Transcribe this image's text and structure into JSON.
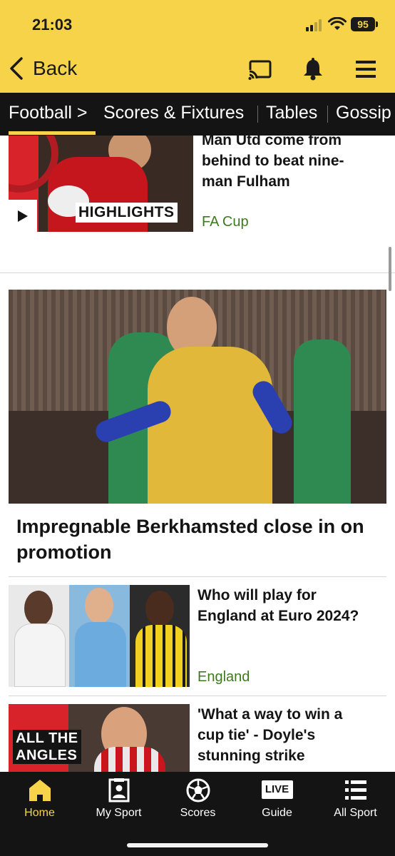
{
  "status_bar": {
    "time": "21:03",
    "battery": "95"
  },
  "header": {
    "back_label": "Back",
    "icons": [
      "cast-icon",
      "bell-icon",
      "menu-icon"
    ]
  },
  "subnav": {
    "items": [
      {
        "label": "Football >",
        "active": true
      },
      {
        "label": "Scores & Fixtures"
      },
      {
        "label": "Tables"
      },
      {
        "label": "Gossip"
      }
    ]
  },
  "articles": [
    {
      "headline_lines": [
        "Man Utd come from",
        "behind to beat nine-",
        "man Fulham"
      ],
      "tag": "FA Cup",
      "thumb_badge": "HIGHLIGHTS",
      "has_play_icon": true
    },
    {
      "headline_lines": [
        "Impregnable Berkhamsted close in on",
        "promotion"
      ]
    },
    {
      "headline_lines": [
        "Who will play for",
        "England at Euro 2024?"
      ],
      "tag": "England"
    },
    {
      "headline_lines": [
        "'What a way to win a",
        "cup tie' - Doyle's",
        "stunning strike"
      ],
      "thumb_badge_lines": [
        "ALL THE",
        "ANGLES"
      ]
    }
  ],
  "tabbar": {
    "tabs": [
      {
        "label": "Home",
        "icon": "home-icon",
        "active": true
      },
      {
        "label": "My Sport",
        "icon": "my-sport-icon"
      },
      {
        "label": "Scores",
        "icon": "football-icon"
      },
      {
        "label": "Guide",
        "icon": "live-icon",
        "icon_text": "LIVE"
      },
      {
        "label": "All Sport",
        "icon": "list-icon"
      }
    ]
  },
  "colors": {
    "brand_yellow": "#f7d34a",
    "nav_dark": "#141414",
    "tag_green": "#3d7a1f"
  }
}
